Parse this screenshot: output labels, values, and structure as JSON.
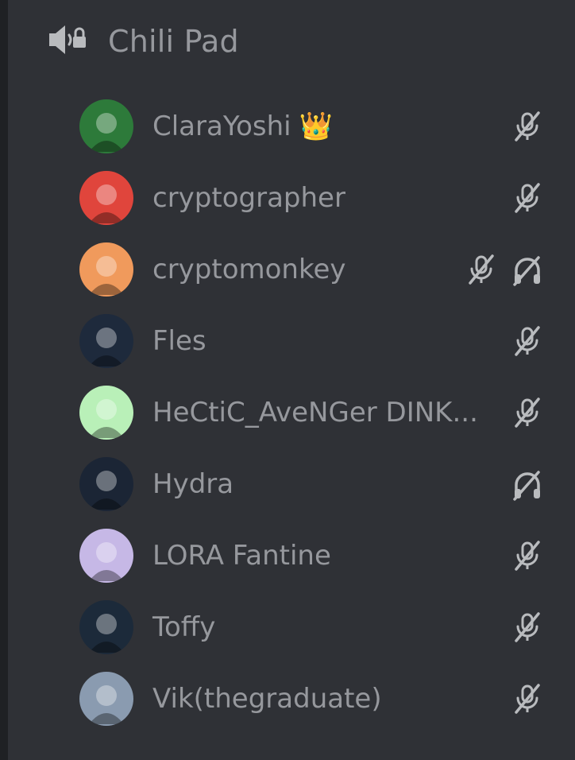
{
  "channel": {
    "icon": "speaker-lock-icon",
    "name": "Chili Pad"
  },
  "users": [
    {
      "name": "ClaraYoshi",
      "badge": "👑",
      "muted": true,
      "deafened": false,
      "avatar_color": "#2d7a3a"
    },
    {
      "name": "cryptographer",
      "muted": true,
      "deafened": false,
      "avatar_color": "#e0453c"
    },
    {
      "name": "cryptomonkey",
      "muted": true,
      "deafened": true,
      "avatar_color": "#f09a5c"
    },
    {
      "name": "Fles",
      "muted": true,
      "deafened": false,
      "avatar_color": "#1e2a3c"
    },
    {
      "name": "HeCtiC_AveNGer DINK...",
      "muted": true,
      "deafened": false,
      "avatar_color": "#b9f0b8"
    },
    {
      "name": "Hydra",
      "muted": false,
      "deafened": true,
      "avatar_color": "#1b2535"
    },
    {
      "name": "LORA Fantine",
      "muted": true,
      "deafened": false,
      "avatar_color": "#c6b8e6"
    },
    {
      "name": "Toffy",
      "muted": true,
      "deafened": false,
      "avatar_color": "#1c2a3a"
    },
    {
      "name": "Vik(thegraduate)",
      "muted": true,
      "deafened": false,
      "avatar_color": "#8a9bb0"
    }
  ],
  "colors": {
    "background": "#2f3136",
    "text": "#96989d",
    "icon": "#b9bbbe"
  }
}
